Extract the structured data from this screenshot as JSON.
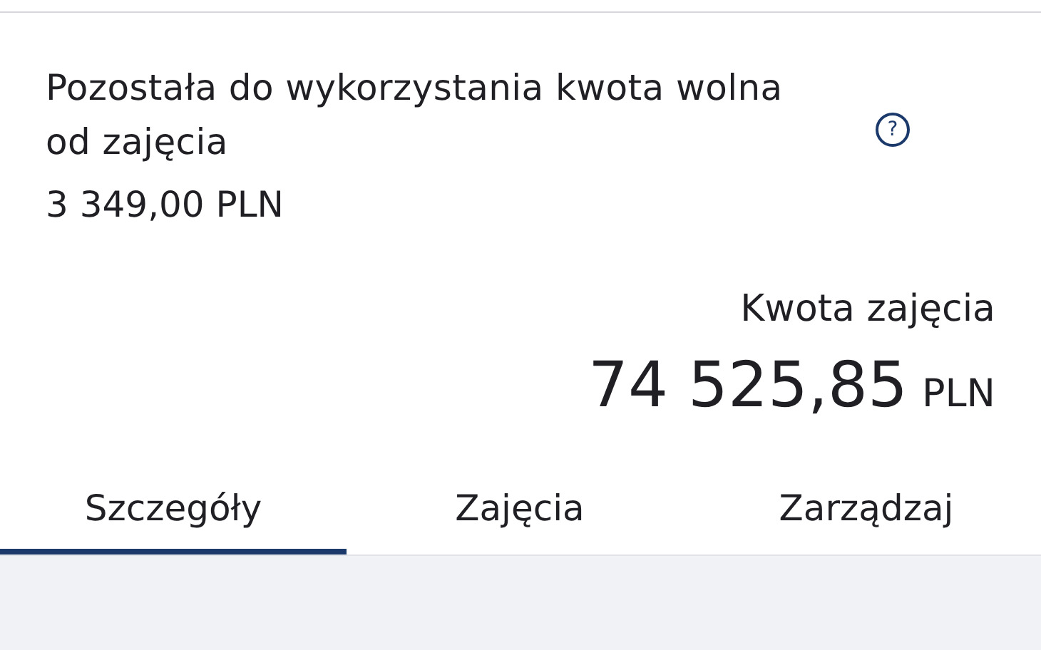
{
  "remaining": {
    "label_line_1": "Pozostała do wykorzystania kwota wolna",
    "label_line_2": "od zajęcia",
    "help": "?",
    "amount": "3 349,00 PLN"
  },
  "seizure": {
    "label": "Kwota zajęcia",
    "amount": "74 525,85",
    "currency": "PLN"
  },
  "tabs": [
    {
      "label": "Szczegóły",
      "selected": true
    },
    {
      "label": "Zajęcia",
      "selected": false
    },
    {
      "label": "Zarządzaj",
      "selected": false
    }
  ]
}
